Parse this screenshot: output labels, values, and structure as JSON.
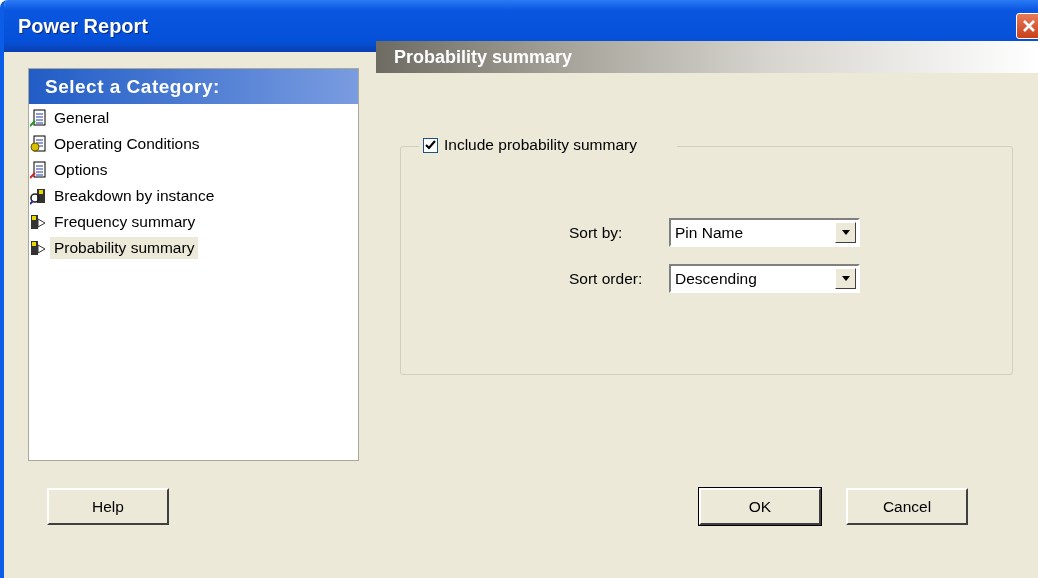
{
  "window": {
    "title": "Power Report"
  },
  "sidebar": {
    "title": "Select a Category:",
    "items": [
      {
        "label": "General",
        "kind": "document",
        "selected": false
      },
      {
        "label": "Operating Conditions",
        "kind": "gear",
        "selected": false
      },
      {
        "label": "Options",
        "kind": "document",
        "selected": false
      },
      {
        "label": "Breakdown by instance",
        "kind": "magnifier",
        "selected": false
      },
      {
        "label": "Frequency summary",
        "kind": "chip",
        "selected": false
      },
      {
        "label": "Probability summary",
        "kind": "chip",
        "selected": true
      }
    ]
  },
  "panel": {
    "title": "Probability summary",
    "include": {
      "label": "Include probability summary",
      "checked": true
    },
    "fields": [
      {
        "label": "Sort by:",
        "value": "Pin Name"
      },
      {
        "label": "Sort order:",
        "value": "Descending"
      }
    ]
  },
  "buttons": [
    {
      "label": "Help",
      "default": false
    },
    {
      "label": "OK",
      "default": true
    },
    {
      "label": "Cancel",
      "default": false
    }
  ]
}
